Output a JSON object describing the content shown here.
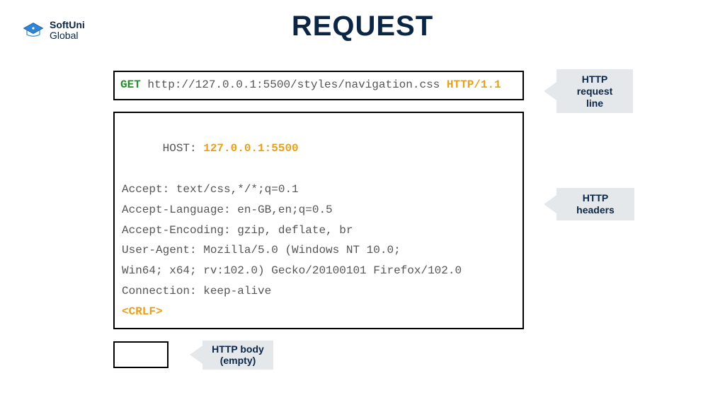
{
  "logo": {
    "top": "SoftUni",
    "bottom": "Global"
  },
  "title": "REQUEST",
  "request_line": {
    "method": "GET",
    "url": " http://127.0.0.1:5500/styles/navigation.css ",
    "protocol": "HTTP/1.1"
  },
  "headers": {
    "host_key": "HOST: ",
    "host_val": "127.0.0.1:5500",
    "accept": "Accept: text/css,*/*;q=0.1",
    "accept_language": "Accept-Language: en-GB,en;q=0.5",
    "accept_encoding": "Accept-Encoding: gzip, deflate, br",
    "user_agent_l1": "User-Agent: Mozilla/5.0 (Windows NT 10.0;",
    "user_agent_l2": "Win64; x64; rv:102.0) Gecko/20100101 Firefox/102.0",
    "connection": "Connection: keep-alive",
    "crlf": "<CRLF>"
  },
  "labels": {
    "request_line": "HTTP request\nline",
    "headers": "HTTP headers",
    "body": "HTTP body\n(empty)"
  },
  "colors": {
    "brand_navy": "#0b2545",
    "method_green": "#2a8a2f",
    "accent_orange": "#e4a11d",
    "arrow_bg": "#e5e8eb"
  }
}
